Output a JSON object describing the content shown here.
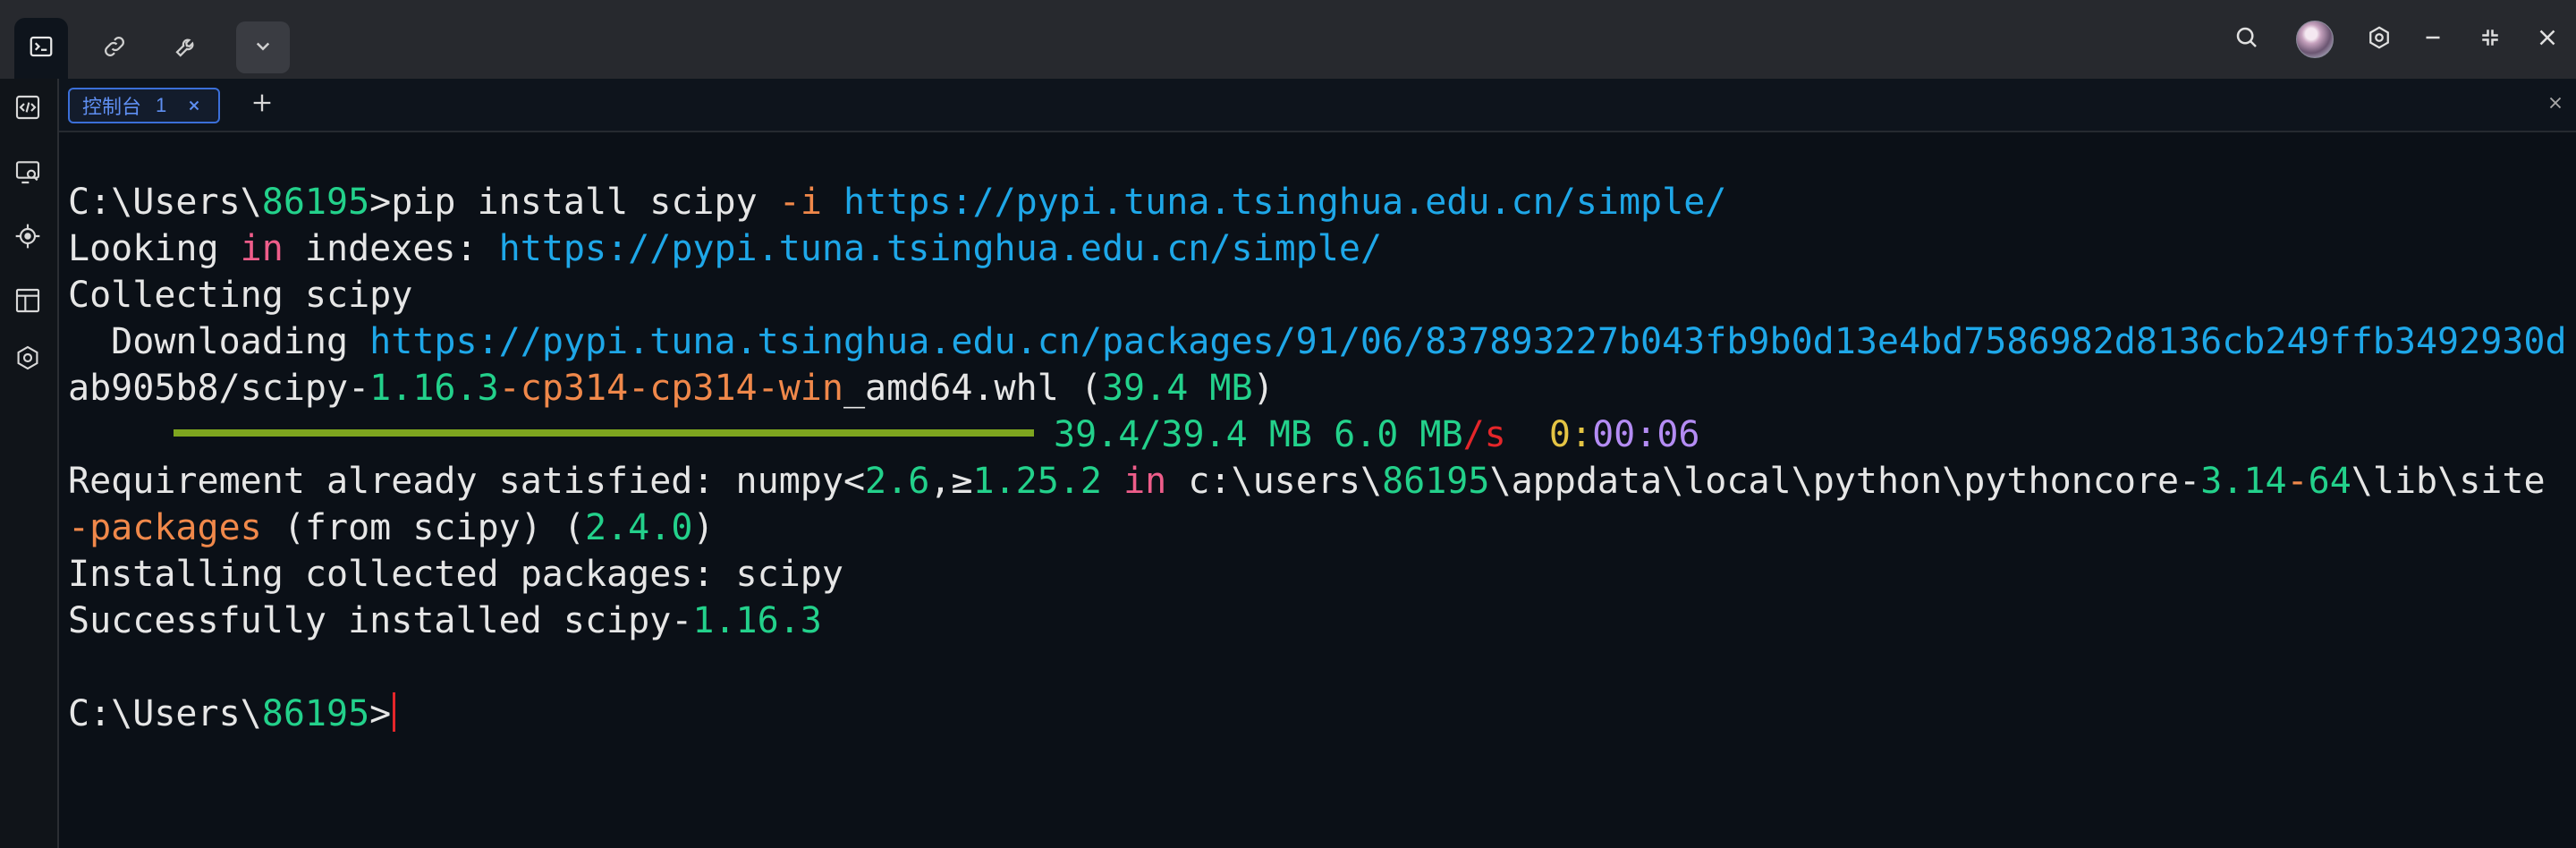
{
  "titlebar": {
    "icons": [
      "terminal-icon",
      "link-icon",
      "wrench-icon",
      "chevron-down-icon"
    ],
    "right_icons": [
      "search-icon",
      "avatar",
      "settings-icon",
      "minimize-icon",
      "restore-icon",
      "close-icon"
    ]
  },
  "sidebar": {
    "icons": [
      "code-panel-icon",
      "screen-search-icon",
      "target-icon",
      "layout-icon",
      "hexagon-settings-icon"
    ]
  },
  "tabs": [
    {
      "label": "控制台",
      "number": "1"
    }
  ],
  "terminal": {
    "lines": [
      [
        {
          "t": "C:\\Users\\"
        },
        {
          "t": "86195",
          "c": "g"
        },
        {
          "t": ">pip install scipy "
        },
        {
          "t": "-i",
          "c": "o"
        },
        {
          "t": " "
        },
        {
          "t": "https://pypi.tuna.tsinghua.edu.cn/simple/",
          "c": "b"
        }
      ],
      [
        {
          "t": "Looking "
        },
        {
          "t": "in",
          "c": "p"
        },
        {
          "t": " indexes: "
        },
        {
          "t": "https://pypi.tuna.tsinghua.edu.cn/simple/",
          "c": "b"
        }
      ],
      [
        {
          "t": "Collecting scipy"
        }
      ],
      [
        {
          "t": "  Downloading "
        },
        {
          "t": "https://pypi.tuna.tsinghua.edu.cn/packages/91/06/837893227b043fb9b0d13e4bd7586982d8136cb249ffb3492930d",
          "c": "b"
        }
      ],
      [
        {
          "t": "ab905b8/scipy-"
        },
        {
          "t": "1.16.3",
          "c": "g"
        },
        {
          "t": "-cp314-cp314-win",
          "c": "o"
        },
        {
          "t": "_amd64.whl ("
        },
        {
          "t": "39.4 MB",
          "c": "g"
        },
        {
          "t": ")"
        }
      ],
      {
        "bar": true,
        "progress": 1.0,
        "after": [
          {
            "t": "39.4/39.4 MB 6.0 MB",
            "c": "g"
          },
          {
            "t": "/s",
            "c": "r"
          },
          {
            "t": "  "
          },
          {
            "t": "0",
            "c": "y"
          },
          {
            "t": ":",
            "c": "y"
          },
          {
            "t": "00:06",
            "c": "v"
          }
        ]
      },
      [
        {
          "t": "Requirement already satisfied: numpy<"
        },
        {
          "t": "2.6",
          "c": "g"
        },
        {
          "t": ",≥"
        },
        {
          "t": "1.25.2",
          "c": "g"
        },
        {
          "t": " "
        },
        {
          "t": "in",
          "c": "p"
        },
        {
          "t": " c:\\users\\"
        },
        {
          "t": "86195",
          "c": "g"
        },
        {
          "t": "\\appdata\\local\\python\\pythoncore-"
        },
        {
          "t": "3.14",
          "c": "g"
        },
        {
          "t": "-",
          "c": "o"
        },
        {
          "t": "64",
          "c": "g"
        },
        {
          "t": "\\lib\\site"
        }
      ],
      [
        {
          "t": "-packages",
          "c": "o"
        },
        {
          "t": " (from scipy) ("
        },
        {
          "t": "2.4.0",
          "c": "g"
        },
        {
          "t": ")"
        }
      ],
      [
        {
          "t": "Installing collected packages: scipy"
        }
      ],
      [
        {
          "t": "Successfully installed scipy-"
        },
        {
          "t": "1.16.3",
          "c": "g"
        }
      ],
      [],
      {
        "prompt": true,
        "segs": [
          {
            "t": "C:\\Users\\"
          },
          {
            "t": "86195",
            "c": "g"
          },
          {
            "t": ">"
          }
        ]
      }
    ]
  },
  "colors": {
    "background": "#0b1017",
    "titlebar": "#27292e",
    "accent": "#3b6fd8",
    "green": "#23d18b",
    "orange": "#f0884a",
    "blue": "#1ea7e8",
    "pink": "#ee5d8a",
    "red": "#e5262a",
    "violet": "#b48cf4"
  }
}
